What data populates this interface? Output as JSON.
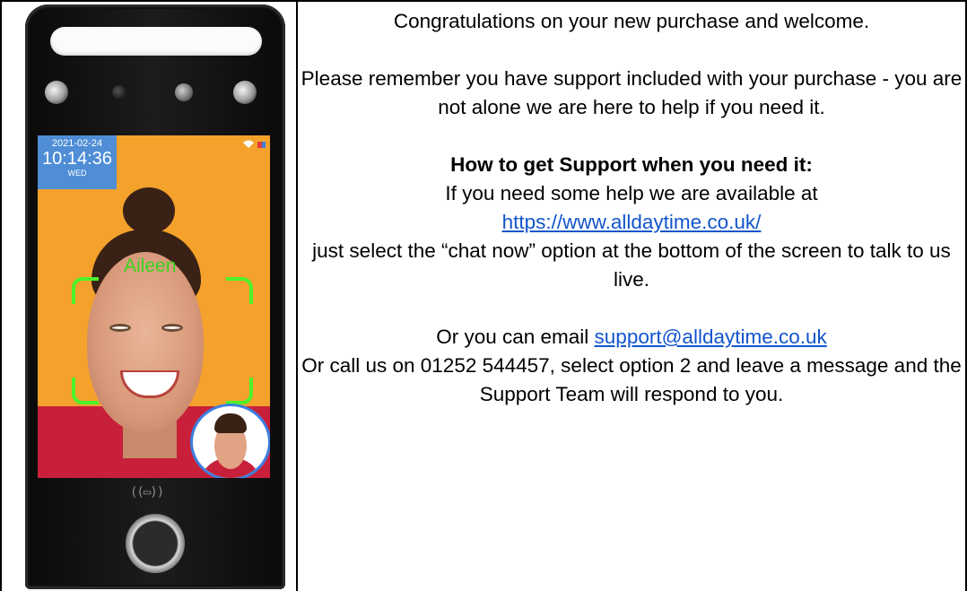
{
  "device": {
    "date": "2021-02-24",
    "time": "10:14:36",
    "day": "WED",
    "recognized_name": "Aileen",
    "icons": [
      "wifi-icon",
      "battery-icon",
      "nfc-reader-icon",
      "fingerprint-sensor-icon"
    ],
    "colors": {
      "screen_background": "#f4a22b",
      "face_frame": "#4cf12b",
      "info_box": "#4f8ed6"
    }
  },
  "content": {
    "welcome": "Congratulations on your new purchase and welcome.",
    "reminder": "Please remember you have support included with your purchase - you are not alone we are here to help if you need it.",
    "heading": "How to get Support when you need it:",
    "available_text": "If you need some help we are available at",
    "website_link": "https://www.alldaytime.co.uk/",
    "chat_text": "just select the “chat now” option at the bottom of the screen to talk to us live.",
    "email_prefix": "Or you can email ",
    "email_link": "support@alldaytime.co.uk",
    "phone_text": "Or call us on 01252 544457, select option 2 and leave a message and the Support Team will respond to you.",
    "link_color": "#1155cc"
  }
}
